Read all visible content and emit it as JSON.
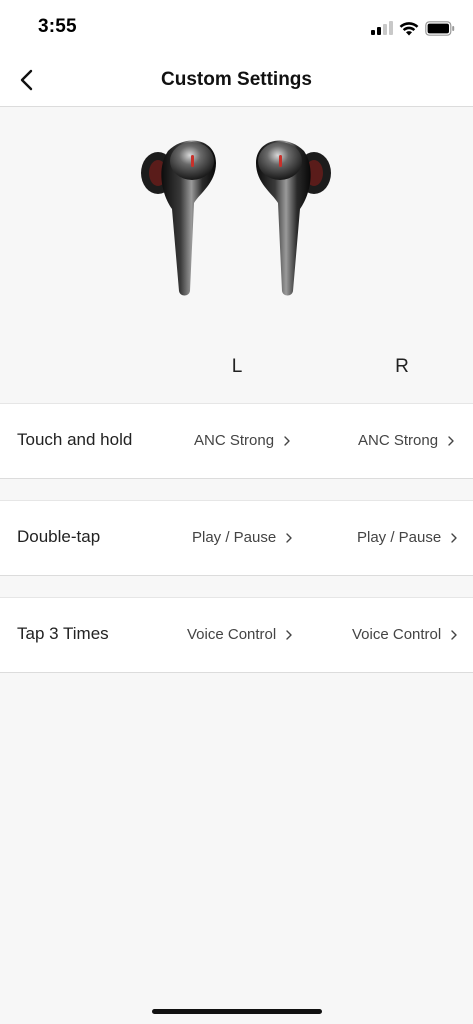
{
  "status_bar": {
    "time": "3:55"
  },
  "nav": {
    "title": "Custom Settings",
    "back_icon": "chevron-left-icon"
  },
  "earbuds": {
    "left_label": "L",
    "right_label": "R"
  },
  "settings": [
    {
      "label": "Touch and hold",
      "left_value": "ANC Strong",
      "right_value": "ANC Strong"
    },
    {
      "label": "Double-tap",
      "left_value": "Play / Pause",
      "right_value": "Play / Pause"
    },
    {
      "label": "Tap 3 Times",
      "left_value": "Voice Control",
      "right_value": "Voice Control"
    }
  ],
  "colors": {
    "background": "#f7f7f7",
    "row_background": "#ffffff",
    "text": "#222222",
    "accent_red": "#c8302a"
  }
}
